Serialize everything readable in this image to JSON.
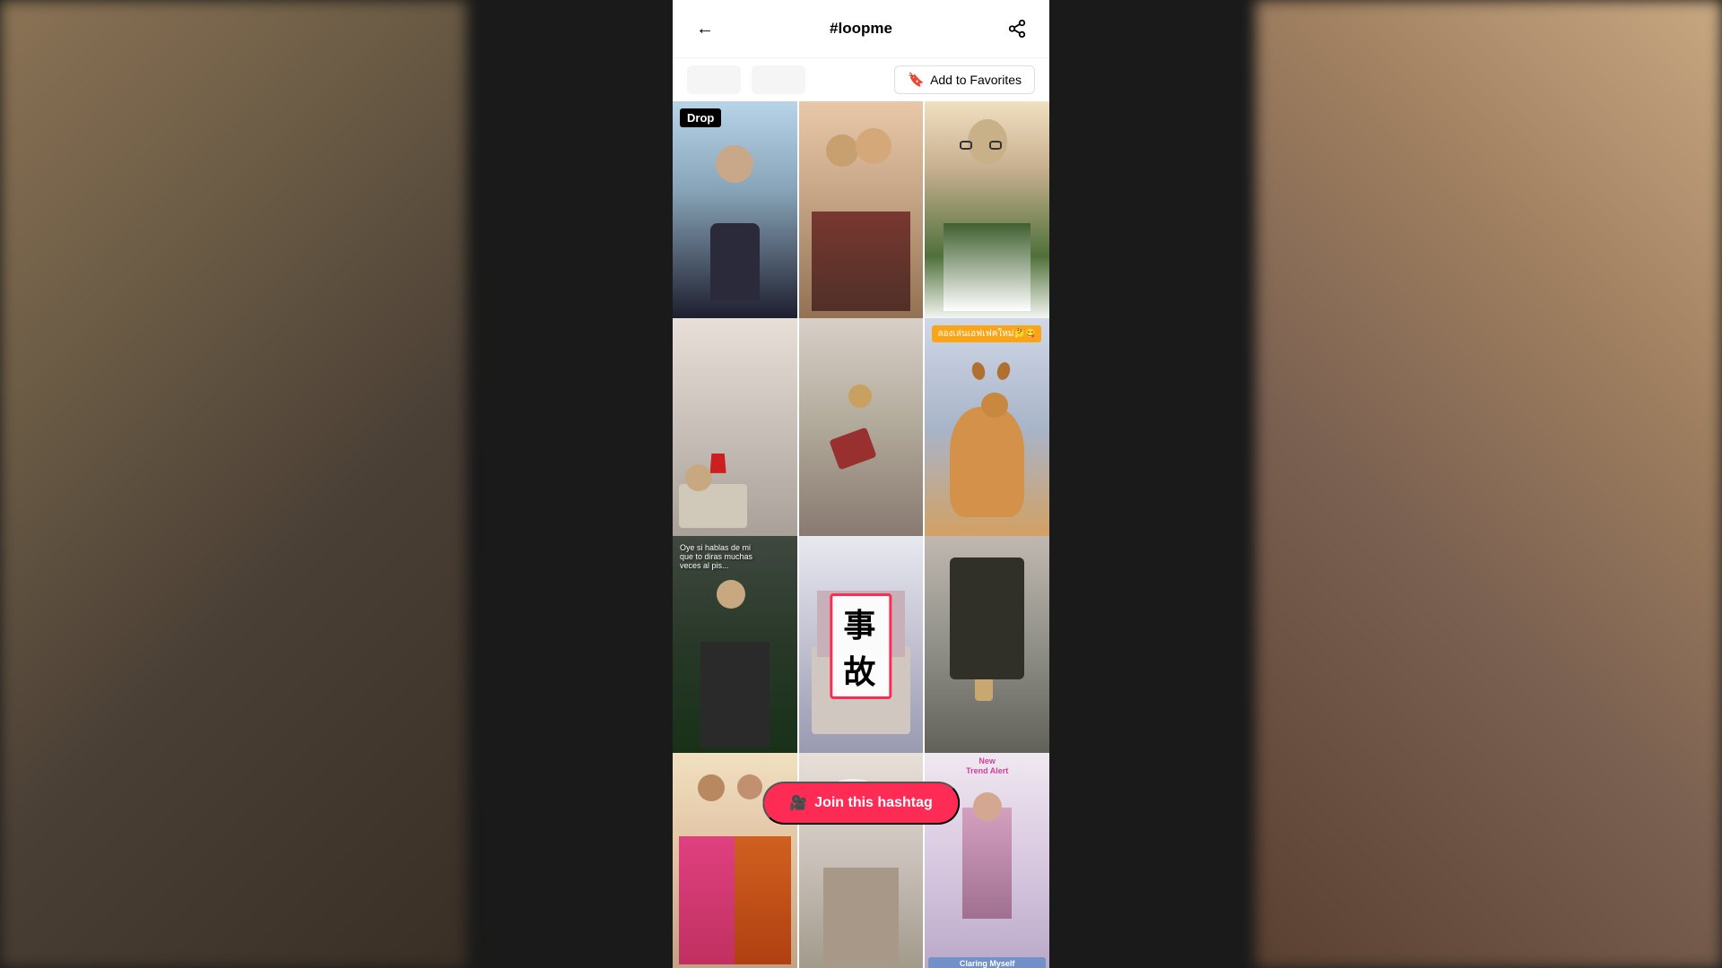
{
  "app": {
    "title": "#loopme",
    "back_label": "←",
    "share_label": "↗"
  },
  "subheader": {
    "stat1": "",
    "stat2": "",
    "add_favorites_label": "Add to Favorites",
    "bookmark_icon": "🔖"
  },
  "grid": {
    "cells": [
      {
        "id": 1,
        "badge": "Drop",
        "badge_color": "#000",
        "scene": "person-male-bald",
        "overlay_text": ""
      },
      {
        "id": 2,
        "badge": "",
        "scene": "person-couple",
        "overlay_text": ""
      },
      {
        "id": 3,
        "badge": "",
        "scene": "person-glasses",
        "overlay_text": ""
      },
      {
        "id": 4,
        "badge": "",
        "scene": "room-scene",
        "overlay_text": ""
      },
      {
        "id": 5,
        "badge": "",
        "scene": "cleaning-scene",
        "overlay_text": ""
      },
      {
        "id": 6,
        "badge": "",
        "scene": "dog-scene",
        "overlay_text": "ลองเล่นเอฟเฟคใหม่🤔😋"
      },
      {
        "id": 7,
        "badge": "",
        "scene": "spanish-scene",
        "overlay_text": "Oye si hablas de mi\nque to diras muchas\nveces al pis..."
      },
      {
        "id": 8,
        "badge": "",
        "scene": "kanji-scene",
        "kanji": "事故",
        "overlay_text": ""
      },
      {
        "id": 9,
        "badge": "",
        "scene": "camera-scene",
        "overlay_text": ""
      },
      {
        "id": 10,
        "badge": "",
        "scene": "sari-scene",
        "overlay_text": ""
      },
      {
        "id": 11,
        "badge": "",
        "scene": "elderly-scene",
        "overlay_text": ""
      },
      {
        "id": 12,
        "badge": "",
        "scene": "trend-scene",
        "overlay_text": "New\nTrend Alert",
        "claring": "Claring Myself"
      }
    ]
  },
  "join_button": {
    "label": "Join this hashtag",
    "cam_icon": "🎥"
  }
}
